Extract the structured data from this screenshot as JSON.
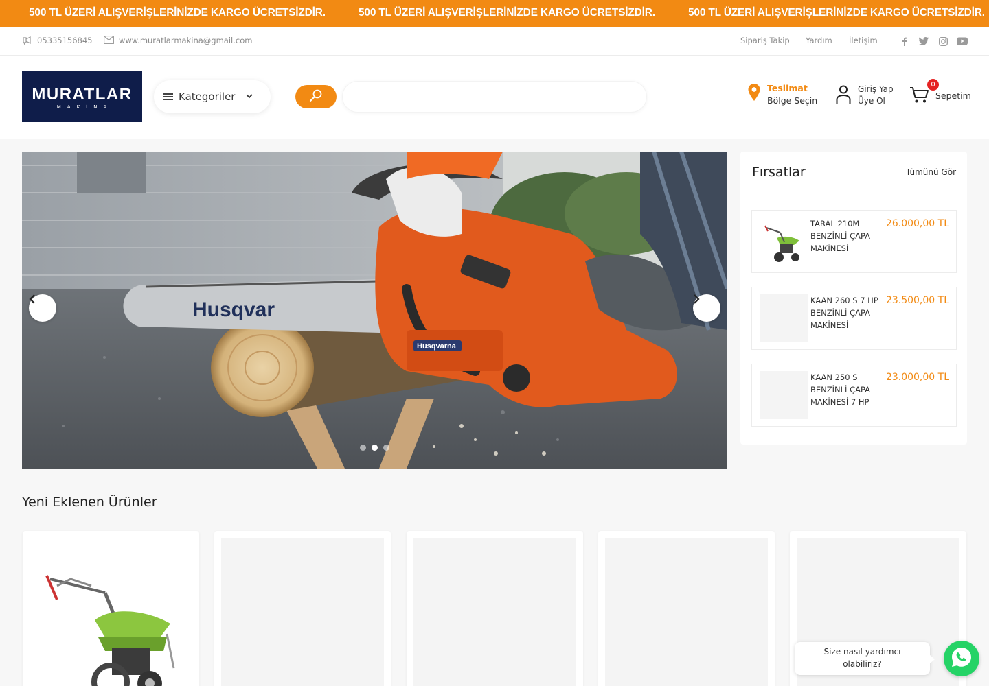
{
  "announcement": {
    "messages": [
      "500 TL ÜZERİ ALIŞVERİŞLERİNİZDE KARGO ÜCRETSİZDİR.",
      "500 TL ÜZERİ ALIŞVERİŞLERİNİZDE KARGO ÜCRETSİZDİR.",
      "500 TL ÜZERİ ALIŞVERİŞLERİNİZDE KARGO ÜCRETSİZDİR."
    ],
    "bg_color": "#f28a13"
  },
  "topbar": {
    "phone": "05335156845",
    "email": "www.muratlarmakina@gmail.com",
    "links": [
      "Sipariş Takip",
      "Yardım",
      "İletişim"
    ],
    "social_icons": [
      "facebook-icon",
      "twitter-icon",
      "instagram-icon",
      "youtube-icon"
    ]
  },
  "header": {
    "logo_main": "MURATLAR",
    "logo_sub": "MAKİNA",
    "categories_label": "Kategoriler",
    "search_placeholder": "",
    "delivery": {
      "title": "Teslimat",
      "subtitle": "Bölge Seçin"
    },
    "account": {
      "login": "Giriş Yap",
      "register": "Üye Ol"
    },
    "cart": {
      "label": "Sepetim",
      "count": "0"
    }
  },
  "slider": {
    "dots": 3,
    "active_index": 1
  },
  "deals": {
    "title": "Fırsatlar",
    "see_all": "Tümünü Gör",
    "items": [
      {
        "name": "TARAL 210M BENZİNLİ ÇAPA MAKİNESİ",
        "price": "26.000,00 TL"
      },
      {
        "name": "KAAN 260 S 7 HP BENZİNLİ ÇAPA MAKİNESİ",
        "price": "23.500,00 TL"
      },
      {
        "name": "KAAN 250 S BENZİNLİ ÇAPA MAKİNESİ 7 HP",
        "price": "23.000,00 TL"
      }
    ]
  },
  "new_products": {
    "title": "Yeni Eklenen Ürünler"
  },
  "chat": {
    "prompt": "Size nasıl yardımcı olabiliriz?"
  },
  "colors": {
    "accent": "#f28a13",
    "logo_bg": "#0f1d4a",
    "badge": "#e52323",
    "whatsapp": "#25d366"
  }
}
